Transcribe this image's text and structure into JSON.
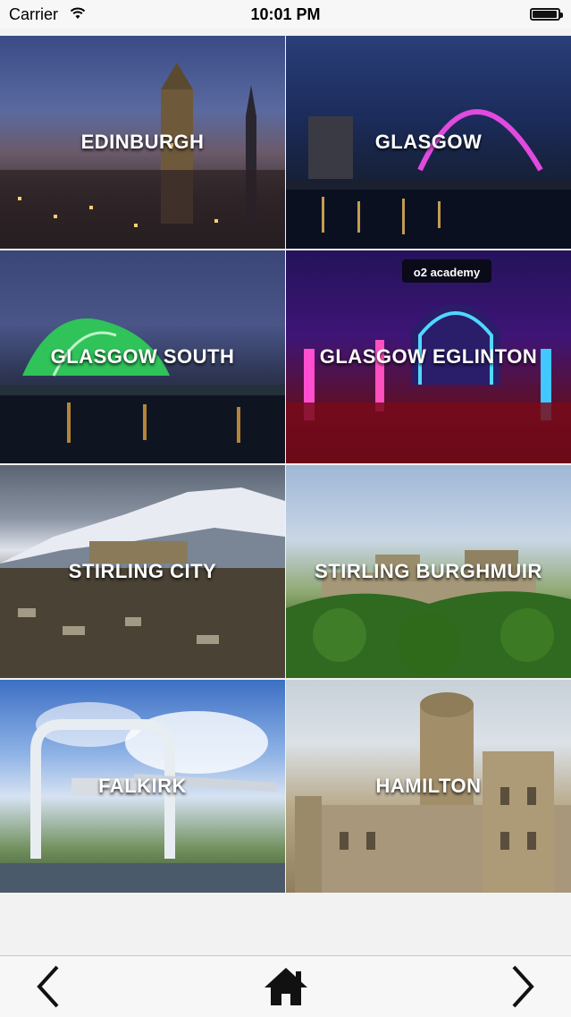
{
  "status_bar": {
    "carrier": "Carrier",
    "time": "10:01 PM",
    "battery_level": 0.9
  },
  "locations": [
    {
      "name": "EDINBURGH"
    },
    {
      "name": "GLASGOW"
    },
    {
      "name": "GLASGOW SOUTH"
    },
    {
      "name": "GLASGOW EGLINTON"
    },
    {
      "name": "STIRLING CITY"
    },
    {
      "name": "STIRLING BURGHMUIR"
    },
    {
      "name": "FALKIRK"
    },
    {
      "name": "HAMILTON"
    }
  ],
  "toolbar": {
    "back_icon": "chevron-left-icon",
    "home_icon": "home-icon",
    "forward_icon": "chevron-right-icon"
  },
  "colors": {
    "toolbar_bg": "#f7f7f7",
    "label_text": "#ffffff"
  }
}
